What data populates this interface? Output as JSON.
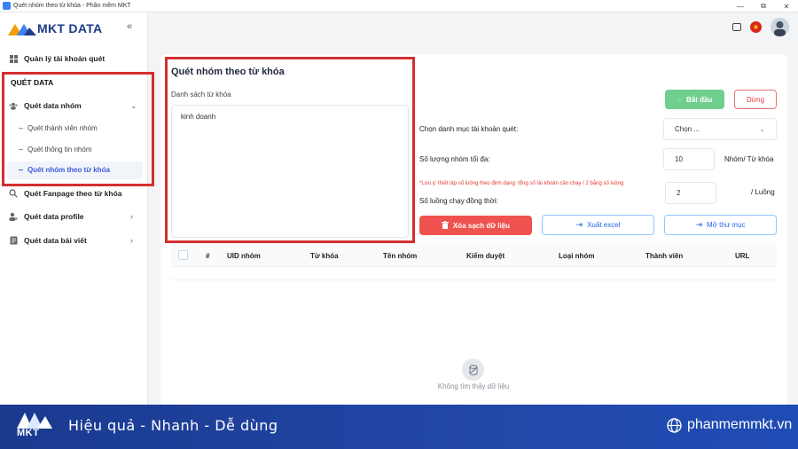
{
  "window": {
    "title": "Quét nhóm theo từ khóa - Phần mềm MKT",
    "controls": [
      "—",
      "⧉",
      "✕"
    ]
  },
  "sidebar": {
    "logo_text": "MKT DATA",
    "collapse_icon": "«",
    "account_item": "Quản lý tài khoản quét",
    "section_label": "QUÉT DATA",
    "group_item": "Quét data nhóm",
    "sub_items": [
      {
        "label": "Quét thành viên nhóm",
        "active": false
      },
      {
        "label": "Quét thông tin nhóm",
        "active": false
      },
      {
        "label": "Quét nhóm theo từ khóa",
        "active": true
      }
    ],
    "fanpage_item": "Quét Fanpage theo từ khóa",
    "profile_item": "Quét data profile",
    "post_item": "Quét data bài viết"
  },
  "main": {
    "title": "Quét nhóm theo từ khóa",
    "keyword_label": "Danh sách từ khóa",
    "keyword_value": "kinh doanh",
    "start_button": "Bắt đầu",
    "stop_button": "Dừng",
    "category_label": "Chọn danh mục tài khoản quét:",
    "category_select": "Chọn ...",
    "max_groups_label": "Số lượng nhóm tối đa:",
    "max_groups_value": "10",
    "max_groups_unit": "Nhóm/ Từ khóa",
    "note": "*Lưu ý: thiết lập số luồng theo định dạng: tổng số tài khoản cần chạy / 2 bằng số luồng",
    "threads_label": "Số luồng chạy đồng thời:",
    "threads_value": "2",
    "threads_unit": "/ Luồng",
    "clear_button": "Xóa sạch dữ liệu",
    "excel_button": "Xuất excel",
    "folder_button": "Mở thư mục"
  },
  "table": {
    "columns": [
      "#",
      "UID nhóm",
      "Từ khóa",
      "Tên nhóm",
      "Kiểm duyệt",
      "Loại nhóm",
      "Thành viên",
      "URL"
    ],
    "empty_text": "Không tìm thấy dữ liệu"
  },
  "footer": {
    "logo_text": "MKT",
    "slogan": "Hiệu quả - Nhanh  - Dễ dùng",
    "website": "phanmemmkt.vn"
  },
  "colors": {
    "accent": "#3b5bdb",
    "start": "#6fcf8e",
    "danger": "#ef5350",
    "highlight": "#d32f2f",
    "footer": "#1f4cb5"
  }
}
